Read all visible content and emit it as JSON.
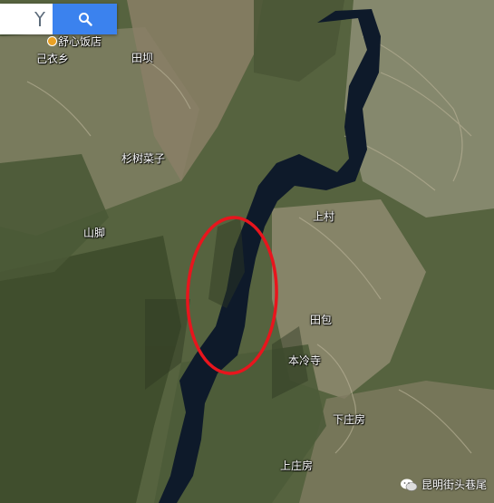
{
  "toolbar": {
    "directions_icon": "directions-icon",
    "search_icon": "search-icon",
    "accent_color": "#3b82ee"
  },
  "map_labels": {
    "restaurant": "舒心饭店",
    "town": "己衣乡",
    "tianba": "田坝",
    "shanshuzizi": "杉树菜子",
    "shanjiao": "山脚",
    "shangcun": "上村",
    "tianbao": "田包",
    "benlengsi": "本冷寺",
    "xiazhuangfang": "下庄房",
    "shangzhuangfang": "上庄房"
  },
  "highlight": {
    "shape": "ellipse",
    "color": "#e8151d"
  },
  "watermark": {
    "text": "昆明街头巷尾",
    "icon": "wechat-icon"
  }
}
